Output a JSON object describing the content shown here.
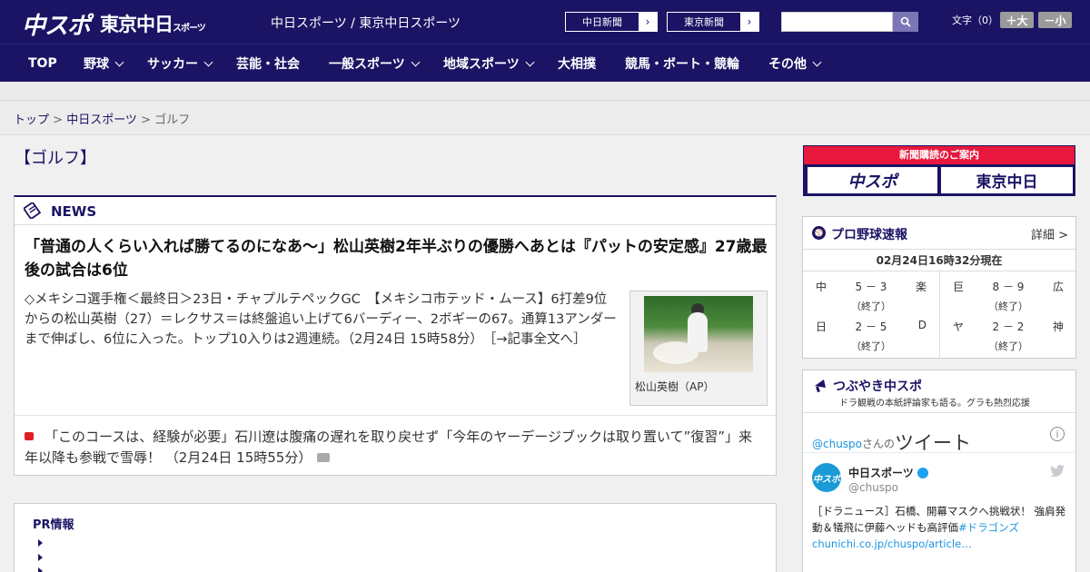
{
  "header": {
    "logo_chuspo": "中スポ",
    "logo_tokyo": "東京中日",
    "logo_tokyo_small": "スポーツ",
    "site_names": "中日スポーツ / 東京中日スポーツ",
    "btn_chunichi": "中日新聞",
    "btn_tokyo": "東京新聞",
    "btn_arrow": "›",
    "search_placeholder": "",
    "font_size_label": "文字（0）",
    "size_up": "＋大",
    "size_down": "－小"
  },
  "nav": {
    "items": [
      {
        "label": "TOP"
      },
      {
        "label": "野球"
      },
      {
        "label": "サッカー"
      },
      {
        "label": "芸能・社会"
      },
      {
        "label": "一般スポーツ"
      },
      {
        "label": "地域スポーツ"
      },
      {
        "label": "大相撲"
      },
      {
        "label": "競馬・ボート・競輪"
      },
      {
        "label": "その他"
      }
    ]
  },
  "breadcrumb": {
    "top": "トップ",
    "sep": " > ",
    "section": "中日スポーツ",
    "current": "ゴルフ"
  },
  "page_title": "【ゴルフ】",
  "news": {
    "title": "NEWS",
    "headline": "「普通の人くらい入れば勝てるのになあ～」松山英樹2年半ぶりの優勝へあとは『パットの安定感』27歳最後の試合は6位",
    "lead": "◇メキシコ選手権＜最終日＞23日・チャプルテペックGC　【メキシコ市テッド・ムース】6打差9位からの松山英樹（27）＝レクサス＝は終盤追い上げて6バーディー、2ボギーの67。通算13アンダーまで伸ばし、6位に入った。トップ10入りは2週連続。（2月24日 15時58分）",
    "more": "［→記事全文へ］",
    "photo_caption": "松山英樹（AP）",
    "sub_item": "「このコースは、経験が必要」石川遼は腹痛の遅れを取り戻せず「今年のヤーデージブックは取り置いて”復習”」来年以降も参戦で雪辱！ （2月24日 15時55分）"
  },
  "pr": {
    "title": "PR情報"
  },
  "sidebar": {
    "subscribe_top": "新聞購読のご案内",
    "subscribe_chuspo": "中スポ",
    "subscribe_tokyo": "東京中日",
    "baseball": {
      "title": "プロ野球速報",
      "detail": "詳細 >",
      "time": "02月24日16時32分現在",
      "games": [
        {
          "home": "中",
          "score": "5 － 3",
          "away": "楽",
          "status": "（終了）"
        },
        {
          "home": "日",
          "score": "2 － 5",
          "away": "D",
          "status": "（終了）"
        },
        {
          "home": "巨",
          "score": "8 － 9",
          "away": "広",
          "status": "（終了）"
        },
        {
          "home": "ヤ",
          "score": "2 － 2",
          "away": "神",
          "status": "（終了）"
        }
      ]
    },
    "twitter": {
      "title": "つぶやき中スポ",
      "subtitle": "ドラ観戦の本紙評論家も語る。グラも熱烈応援",
      "handle": "@chuspo",
      "handle_suffix": "さんの",
      "tweets_label": "ツイート",
      "info": "i",
      "avatar_text": "中スポ",
      "name": "中日スポーツ",
      "user": "@chuspo",
      "text": "［ドラニュース］石橋、開幕マスクへ挑戦状！ 強肩発動＆犠飛に伊藤ヘッドも高評価",
      "hashtag": "#ドラゴンズ",
      "link": "chunichi.co.jp/chuspo/article…"
    }
  },
  "colors": {
    "brand": "#1b1464",
    "accent_red": "#e8173d",
    "twitter_blue": "#1b95e0"
  }
}
